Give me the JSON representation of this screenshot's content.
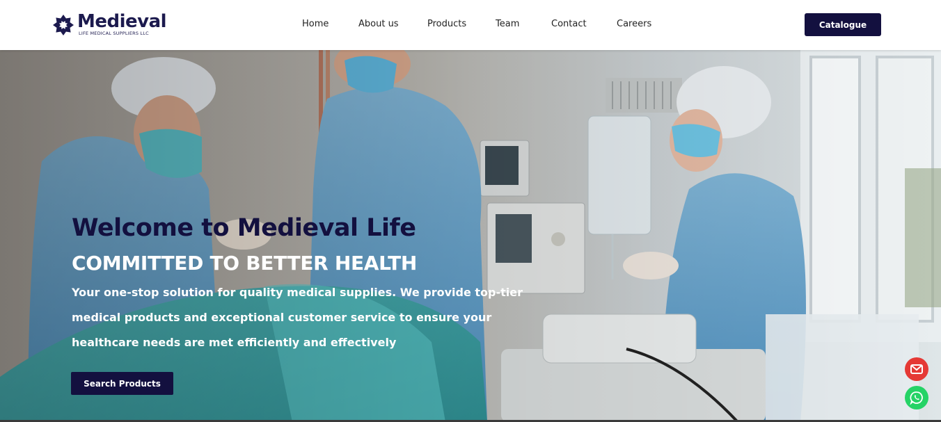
{
  "brand": {
    "name": "Medieval",
    "tagline": "LIFE MEDICAL SUPPLIERS LLC",
    "primary_color": "#13103f",
    "logo_icon": "flower-logo-icon"
  },
  "nav": {
    "items": [
      {
        "label": "Home"
      },
      {
        "label": "About us"
      },
      {
        "label": "Products"
      },
      {
        "label": "Team"
      },
      {
        "label": "Contact"
      },
      {
        "label": "Careers"
      }
    ],
    "catalogue_label": "Catalogue"
  },
  "hero": {
    "title": "Welcome to Medieval Life",
    "subtitle": "COMMITTED TO BETTER HEALTH",
    "description": "Your one-stop solution for quality medical supplies. We provide top-tier medical products and exceptional customer service to ensure your healthcare needs are met efficiently and effectively",
    "cta_label": "Search Products"
  },
  "floating": {
    "mail_icon": "mail-icon",
    "mail_color": "#e53935",
    "whatsapp_icon": "whatsapp-icon",
    "whatsapp_color": "#25d366"
  }
}
